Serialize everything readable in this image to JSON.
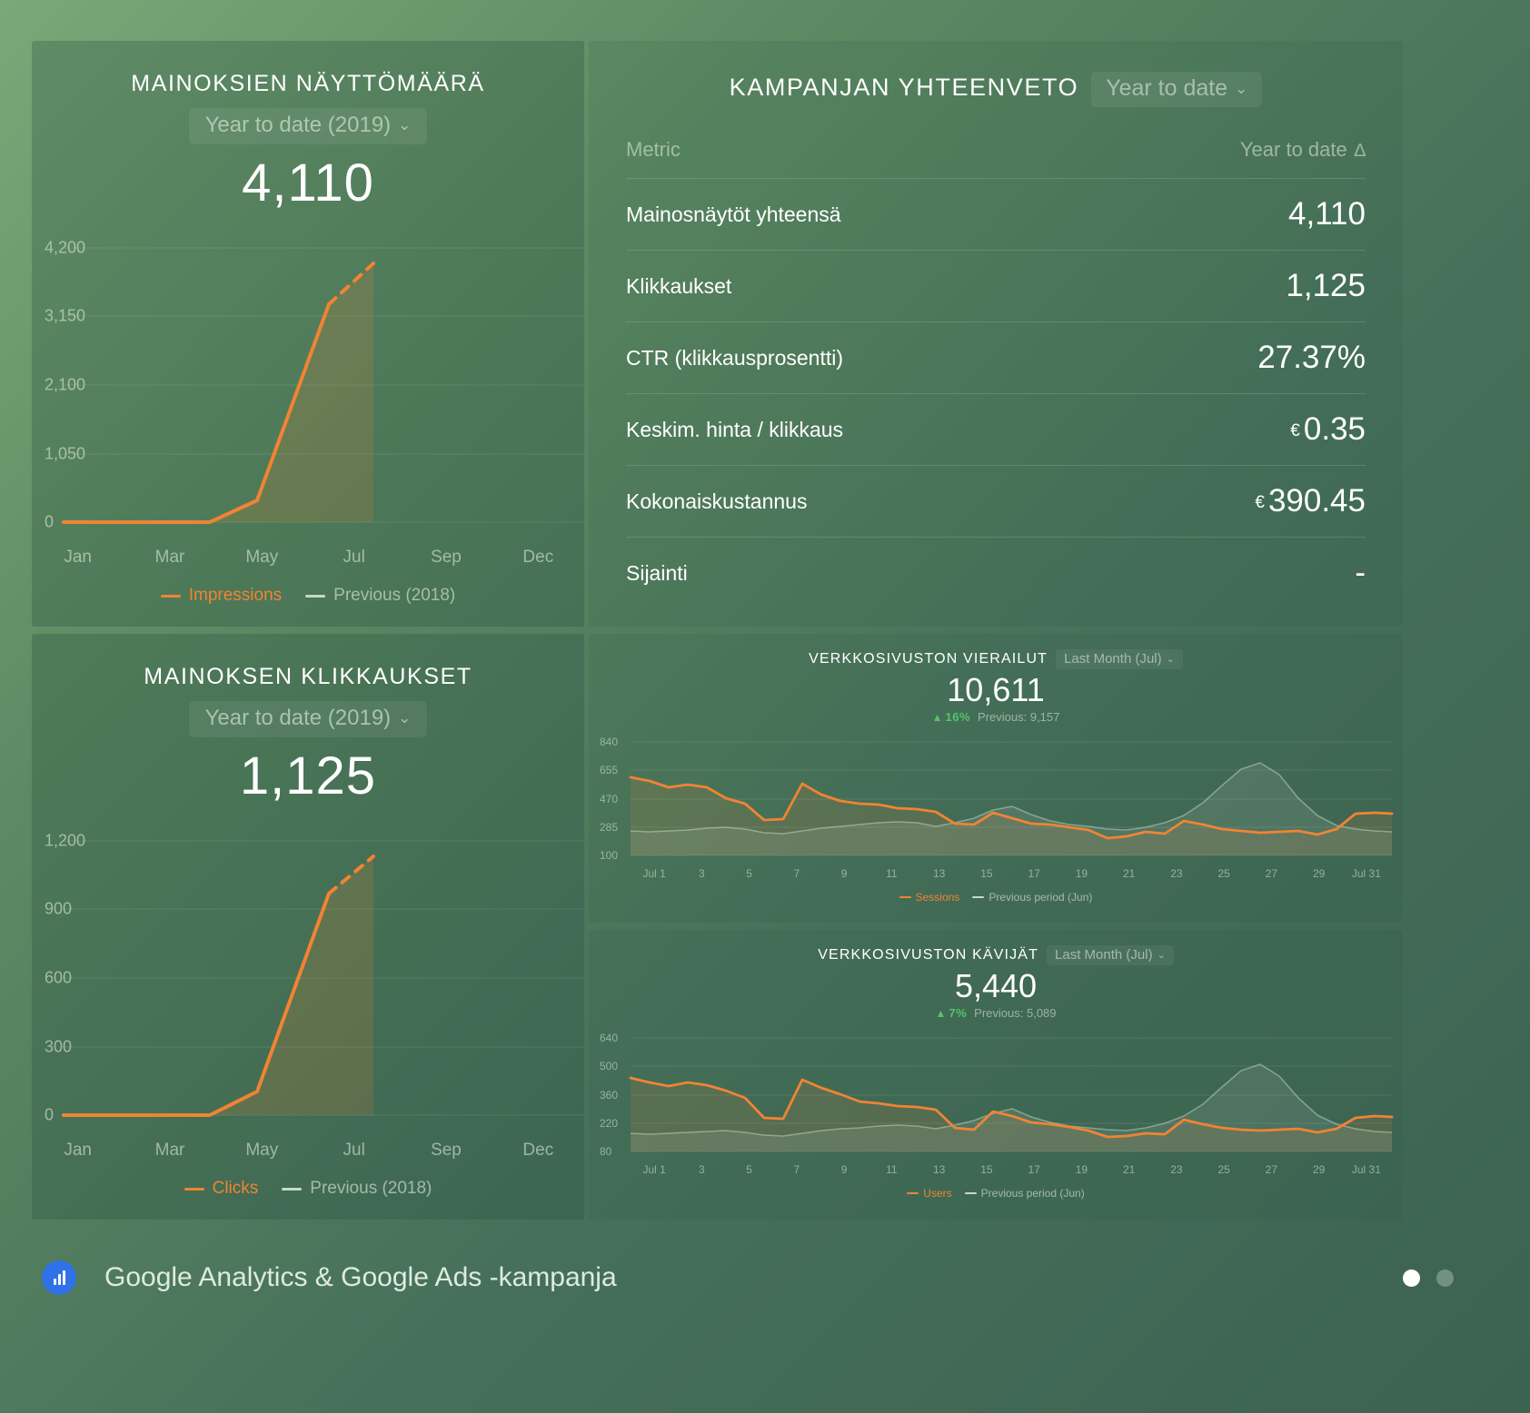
{
  "theme": {
    "accent": "#f08433",
    "previous_line": "#c9d8c9",
    "positive": "#55c46a",
    "background_start": "#7aa878",
    "background_end": "#3c6252"
  },
  "impressions_card": {
    "title": "Mainoksien näyttömäärä",
    "date_range": "Year to date (2019)",
    "chevron": "⌄",
    "value": "4,110",
    "legend": [
      {
        "label": "Impressions",
        "color": "#f08433"
      },
      {
        "label": "Previous (2018)",
        "color": "#c9d8c9"
      }
    ]
  },
  "clicks_card": {
    "title": "Mainoksen klikkaukset",
    "date_range": "Year to date (2019)",
    "chevron": "⌄",
    "value": "1,125",
    "legend": [
      {
        "label": "Clicks",
        "color": "#f08433"
      },
      {
        "label": "Previous (2018)",
        "color": "#c9d8c9"
      }
    ]
  },
  "summary_card": {
    "title": "Kampanjan yhteenveto",
    "date_range": "Year to date",
    "chevron": "⌄",
    "columns": {
      "metric": "Metric",
      "value": "Year to date",
      "delta_icon": "∆"
    },
    "rows": [
      {
        "metric": "Mainosnäytöt yhteensä",
        "currency": "",
        "value": "4,110"
      },
      {
        "metric": "Klikkaukset",
        "currency": "",
        "value": "1,125"
      },
      {
        "metric": "CTR (klikkausprosentti)",
        "currency": "",
        "value": "27.37%"
      },
      {
        "metric": "Keskim. hinta / klikkaus",
        "currency": "€",
        "value": "0.35"
      },
      {
        "metric": "Kokonaiskustannus",
        "currency": "€",
        "value": "390.45"
      },
      {
        "metric": "Sijainti",
        "currency": "",
        "value": "-"
      }
    ]
  },
  "sessions_card": {
    "title": "Verkkosivuston vierailut",
    "date_range": "Last Month (Jul)",
    "chevron": "⌄",
    "value": "10,611",
    "trend_icon": "▲",
    "trend_pct": "16%",
    "previous_label": "Previous: 9,157",
    "legend": [
      {
        "label": "Sessions",
        "color": "#f08433"
      },
      {
        "label": "Previous period (Jun)",
        "color": "#c9d8c9"
      }
    ]
  },
  "users_card": {
    "title": "Verkkosivuston kävijät",
    "date_range": "Last Month (Jul)",
    "chevron": "⌄",
    "value": "5,440",
    "trend_icon": "▲",
    "trend_pct": "7%",
    "previous_label": "Previous: 5,089",
    "legend": [
      {
        "label": "Users",
        "color": "#f08433"
      },
      {
        "label": "Previous period (Jun)",
        "color": "#c9d8c9"
      }
    ]
  },
  "footer": {
    "title": "Google Analytics & Google Ads -kampanja",
    "page_dots": 2,
    "active_dot": 0
  },
  "chart_data": [
    {
      "id": "impressions",
      "type": "area",
      "title": "Mainoksien näyttömäärä",
      "ylabel": "",
      "xlabel": "",
      "ylim": [
        0,
        4200
      ],
      "yticks": [
        "0",
        "1,050",
        "2,100",
        "3,150",
        "4,200"
      ],
      "ytick_values": [
        0,
        1050,
        2100,
        3150,
        4200
      ],
      "xticks": [
        "Jan",
        "Mar",
        "May",
        "Jul",
        "Sep",
        "Dec"
      ],
      "grid": true,
      "legend_position": "bottom",
      "series": [
        {
          "name": "Impressions",
          "color": "#f08433",
          "x": [
            "Jan",
            "Feb",
            "Mar",
            "Apr",
            "May",
            "Jun",
            "Jul"
          ],
          "values": [
            10,
            10,
            10,
            10,
            330,
            1750,
            3210
          ],
          "projected": {
            "x": [
              "Jul",
              "Aug"
            ],
            "values": [
              3210,
              4110
            ],
            "style": "dashed"
          }
        },
        {
          "name": "Previous (2018)",
          "color": "#c9d8c9",
          "x": [],
          "values": []
        }
      ]
    },
    {
      "id": "clicks",
      "type": "area",
      "title": "Mainoksen klikkaukset",
      "ylabel": "",
      "xlabel": "",
      "ylim": [
        0,
        1200
      ],
      "yticks": [
        "0",
        "300",
        "600",
        "900",
        "1,200"
      ],
      "ytick_values": [
        0,
        300,
        600,
        900,
        1200
      ],
      "xticks": [
        "Jan",
        "Mar",
        "May",
        "Jul",
        "Sep",
        "Dec"
      ],
      "grid": true,
      "legend_position": "bottom",
      "series": [
        {
          "name": "Clicks",
          "color": "#f08433",
          "x": [
            "Jan",
            "Feb",
            "Mar",
            "Apr",
            "May",
            "Jun",
            "Jul"
          ],
          "values": [
            8,
            8,
            8,
            8,
            105,
            520,
            915
          ],
          "projected": {
            "x": [
              "Jul",
              "Aug"
            ],
            "values": [
              915,
              1125
            ],
            "style": "dashed"
          }
        },
        {
          "name": "Previous (2018)",
          "color": "#c9d8c9",
          "x": [],
          "values": []
        }
      ]
    },
    {
      "id": "sessions",
      "type": "area",
      "title": "Verkkosivuston vierailut",
      "ylim": [
        100,
        840
      ],
      "yticks": [
        "840",
        "655",
        "470",
        "285",
        "100"
      ],
      "ytick_values": [
        840,
        655,
        470,
        285,
        100
      ],
      "xticks": [
        "Jul 1",
        "3",
        "5",
        "7",
        "9",
        "11",
        "13",
        "15",
        "17",
        "19",
        "21",
        "23",
        "25",
        "27",
        "29",
        "Jul 31"
      ],
      "grid": true,
      "legend_position": "bottom",
      "series": [
        {
          "name": "Sessions",
          "color": "#f08433",
          "values": [
            610,
            585,
            545,
            560,
            540,
            470,
            430,
            325,
            330,
            560,
            490,
            450,
            430,
            425,
            400,
            390,
            375,
            300,
            290,
            370,
            335,
            300,
            290,
            275,
            260,
            215,
            225,
            250,
            240,
            320,
            300,
            270,
            255,
            245,
            250,
            255,
            230,
            260,
            340,
            345,
            340
          ]
        },
        {
          "name": "Previous period (Jun)",
          "color": "#c9d8c9",
          "values": [
            250,
            245,
            250,
            255,
            265,
            270,
            260,
            240,
            235,
            250,
            270,
            280,
            290,
            300,
            305,
            300,
            280,
            300,
            330,
            380,
            400,
            350,
            310,
            290,
            280,
            265,
            260,
            275,
            300,
            340,
            420,
            540,
            640,
            680,
            600,
            470,
            360,
            300,
            280,
            270,
            265
          ]
        }
      ]
    },
    {
      "id": "users",
      "type": "area",
      "title": "Verkkosivuston kävijät",
      "ylim": [
        80,
        640
      ],
      "yticks": [
        "640",
        "500",
        "360",
        "220",
        "80"
      ],
      "ytick_values": [
        640,
        500,
        360,
        220,
        80
      ],
      "xticks": [
        "Jul 1",
        "3",
        "5",
        "7",
        "9",
        "11",
        "13",
        "15",
        "17",
        "19",
        "21",
        "23",
        "25",
        "27",
        "29",
        "Jul 31"
      ],
      "grid": true,
      "legend_position": "bottom",
      "series": [
        {
          "name": "Users",
          "color": "#f08433",
          "values": [
            430,
            410,
            395,
            410,
            400,
            380,
            350,
            250,
            245,
            420,
            390,
            360,
            330,
            320,
            310,
            305,
            295,
            225,
            215,
            290,
            270,
            245,
            240,
            230,
            215,
            190,
            195,
            205,
            200,
            260,
            245,
            230,
            220,
            215,
            220,
            225,
            205,
            225,
            270,
            275,
            270
          ]
        },
        {
          "name": "Previous period (Jun)",
          "color": "#c9d8c9",
          "values": [
            200,
            195,
            200,
            205,
            210,
            215,
            205,
            190,
            185,
            200,
            215,
            225,
            230,
            240,
            245,
            240,
            225,
            240,
            265,
            300,
            320,
            280,
            250,
            235,
            225,
            215,
            210,
            220,
            240,
            270,
            340,
            430,
            510,
            545,
            480,
            380,
            290,
            245,
            225,
            220,
            215
          ]
        }
      ]
    }
  ]
}
